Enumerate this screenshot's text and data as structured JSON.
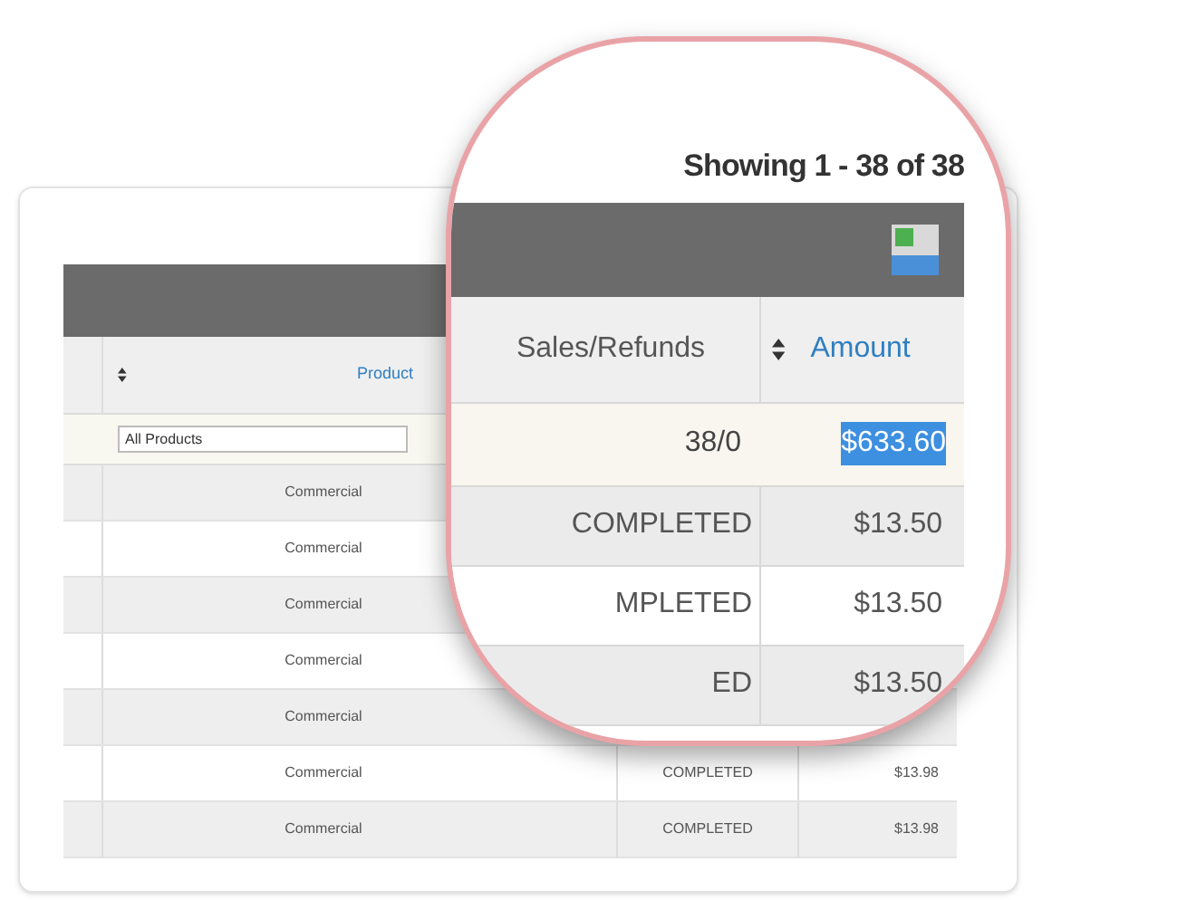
{
  "table": {
    "columns": [
      {
        "label": "Product",
        "kind": "link",
        "sortable": true
      }
    ],
    "filter": {
      "value": "All Products"
    },
    "rows": [
      {
        "product": "Commercial"
      },
      {
        "product": "Commercial"
      },
      {
        "product": "Commercial"
      },
      {
        "product": "Commercial"
      },
      {
        "product": "Commercial"
      },
      {
        "product": "Commercial",
        "status": "COMPLETED",
        "amount": "$13.98"
      },
      {
        "product": "Commercial",
        "status": "COMPLETED",
        "amount": "$13.98"
      }
    ]
  },
  "magnifier": {
    "summary": "Showing 1 - 38 of 38",
    "columns": [
      {
        "label": "Sales/Refunds",
        "kind": "plain",
        "sortable": false
      },
      {
        "label": "Amount",
        "kind": "link",
        "sortable": true
      }
    ],
    "totals": {
      "count": "38/0",
      "amount": "$633.60",
      "amount_selected": true
    },
    "rows": [
      {
        "status": "COMPLETED",
        "amount": "$13.50"
      },
      {
        "status": "MPLETED",
        "amount": "$13.50"
      },
      {
        "status": "ED",
        "amount": "$13.50"
      }
    ]
  }
}
